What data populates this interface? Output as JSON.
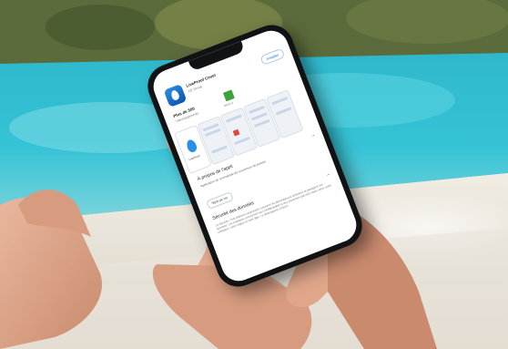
{
  "scene": {
    "description_colors": {
      "pool_water": "#35c3d6",
      "pool_deep": "#1a9fb8",
      "tile_edge": "#eae6dc",
      "skin": "#e7b39a",
      "skin_shadow": "#c98a6e",
      "phone_body": "#101214"
    }
  },
  "app_store_page": {
    "app_name": "LiveProof Cover",
    "developer": "CE Group",
    "install_label": "Installer",
    "downloads_value": "Plus de 500",
    "downloads_label": "Téléchargements",
    "pegi_label": "PEGI 3",
    "screenshot_caption": "LiveProof",
    "about_title": "À propos de l'appli",
    "about_arrow": "→",
    "about_text": "Application de commande de couverture de piscine",
    "category_chip": "Style de vie",
    "privacy_title": "Sécurité des données",
    "privacy_arrow": "→",
    "privacy_text": "La sécurité, c'est d'abord comprendre comment les développeurs collectent et partagent vos données. Les pratiques concernant leur confidentialité et leur protection peuvent varier selon votre utilisation, votre région et votre âge. Le développeur a fourni"
  }
}
